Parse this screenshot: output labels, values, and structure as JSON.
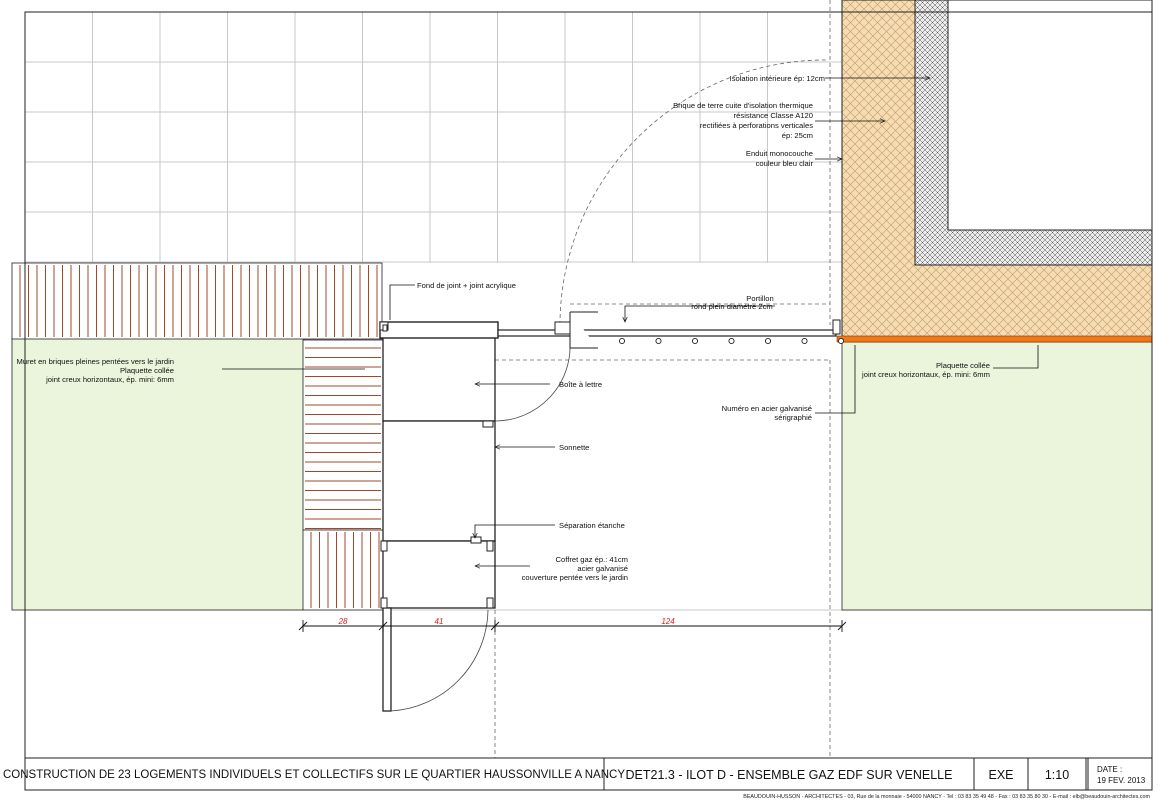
{
  "annotations": {
    "isolation": "Isolation intérieure ép: 12cm",
    "brique_1": "Brique de terre cuite d'isolation thermique",
    "brique_2": "résistance Classe A120",
    "brique_3": "rectifiées à perforations verticales",
    "brique_4": "ép: 25cm",
    "enduit_1": "Enduit monocouche",
    "enduit_2": "couleur bleu clair",
    "fond_joint": "Fond de joint + joint acrylique",
    "portillon_1": "Portillon",
    "portillon_2": "rond plein diamètre 2cm",
    "muret_1": "Muret en briques pleines pentées vers le jardin",
    "muret_2": "Plaquette collée",
    "muret_3": "joint creux horizontaux, ép. mini: 6mm",
    "boite_lettre": "Boîte à lettre",
    "numero_1": "Numéro en acier galvanisé",
    "numero_2": "sérigraphié",
    "plaquette_1": "Plaquette collée",
    "plaquette_2": "joint creux horizontaux, ép. mini: 6mm",
    "sonnette": "Sonnette",
    "separation": "Séparation étanche",
    "coffret_1": "Coffret gaz ép.: 41cm",
    "coffret_2": "acier galvanisé",
    "coffret_3": "couverture pentée vers le jardin"
  },
  "dimensions": {
    "d1": "28",
    "d2": "41",
    "d3": "124"
  },
  "title_block": {
    "project": "CONSTRUCTION DE 23 LOGEMENTS INDIVIDUELS ET COLLECTIFS SUR LE QUARTIER HAUSSONVILLE A NANCY",
    "drawing": "DET21.3 - ILOT  D - ENSEMBLE GAZ EDF SUR VENELLE",
    "phase": "EXE",
    "scale": "1:10",
    "date_label": "DATE :",
    "date_value": "19 FEV. 2013",
    "footer": "BEAUDOUIN-HUSSON - ARCHITECTES - 03, Rue de la monnaie - 54000  NANCY - Tel : 03 83 35 49 48 - Fax : 03 83 35 80 30 - E-mail : elb@beaudouin-architectes.com"
  },
  "colors": {
    "grid": "#c8c8c8",
    "green_fill": "#eaf5dc",
    "brick": "#a04a2a",
    "insulation_bg": "#f5dcb4",
    "orange_band": "#f07818",
    "dim_red": "#e0201a",
    "line": "#222222"
  }
}
